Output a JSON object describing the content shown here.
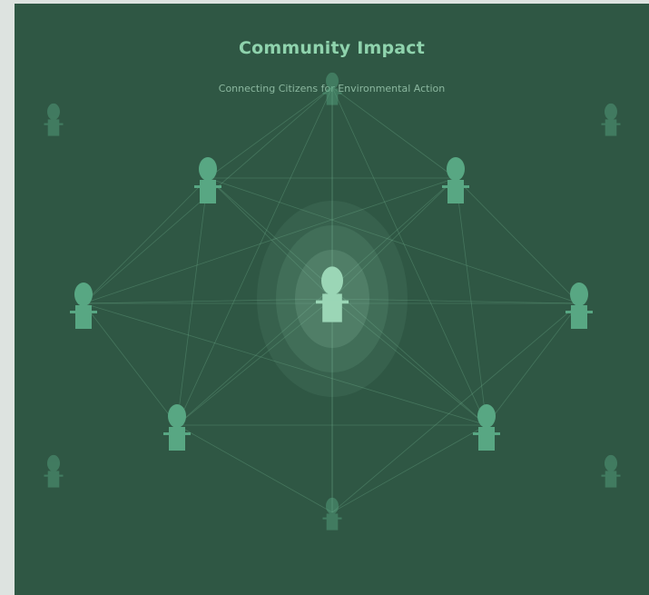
{
  "diagram": {
    "title": "Community Impact",
    "subtitle": "Connecting Citizens for Environmental Action",
    "colors": {
      "background": "#2f5744",
      "page": "#dde3e0",
      "title": "#8fd3ad",
      "subtitle": "#8bb79f",
      "node": "#58a783",
      "hub": "#9bd6b6",
      "link": "#6fae8c"
    },
    "icons": {
      "person": "person-icon",
      "hub": "central-person-icon"
    }
  }
}
